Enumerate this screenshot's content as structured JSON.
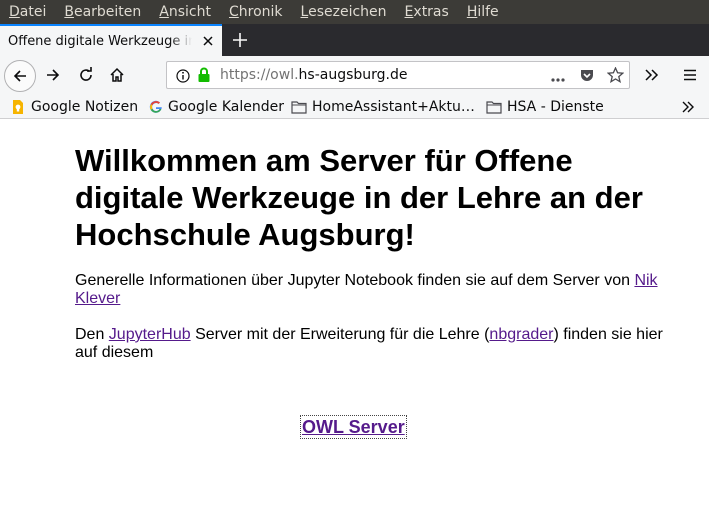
{
  "menubar": {
    "items": [
      {
        "first": "D",
        "rest": "atei"
      },
      {
        "first": "B",
        "rest": "earbeiten"
      },
      {
        "first": "A",
        "rest": "nsicht"
      },
      {
        "first": "C",
        "rest": "hronik"
      },
      {
        "first": "L",
        "rest": "esezeichen"
      },
      {
        "first": "E",
        "rest": "xtras"
      },
      {
        "first": "H",
        "rest": "ilfe"
      }
    ]
  },
  "tab": {
    "title": "Offene digitale Werkzeuge in der Lehre an der Hochschule Augsburg"
  },
  "urlbar": {
    "scheme": "https://owl.",
    "host": "hs-augsburg.de"
  },
  "bookmarks": {
    "items": [
      {
        "label": "Google Notizen",
        "icon": "google-keep-icon"
      },
      {
        "label": "Google Kalender",
        "icon": "google-icon"
      },
      {
        "label": "HomeAssistant+Aktu…",
        "icon": "folder-icon"
      },
      {
        "label": "HSA - Dienste",
        "icon": "folder-icon"
      }
    ]
  },
  "page": {
    "title": "Willkommen am Server für Offene digitale Werkzeuge in der Lehre an der Hochschule Augsburg!",
    "para1_text": "Generelle Informationen über Jupyter Notebook finden sie auf dem Server von ",
    "para1_link": "Nik Klever",
    "para2_pre": "Den ",
    "para2_link1": "JupyterHub",
    "para2_mid": " Server mit der Erweiterung für die Lehre (",
    "para2_link2": "nbgrader",
    "para2_post": ") finden sie hier auf diesem",
    "owl_link": "OWL Server"
  },
  "colors": {
    "menubar_bg": "#3c3b37",
    "tabstrip_bg": "#2a2a2e",
    "accent": "#0a84ff",
    "link": "#551a8b",
    "lock": "#12bc00"
  }
}
